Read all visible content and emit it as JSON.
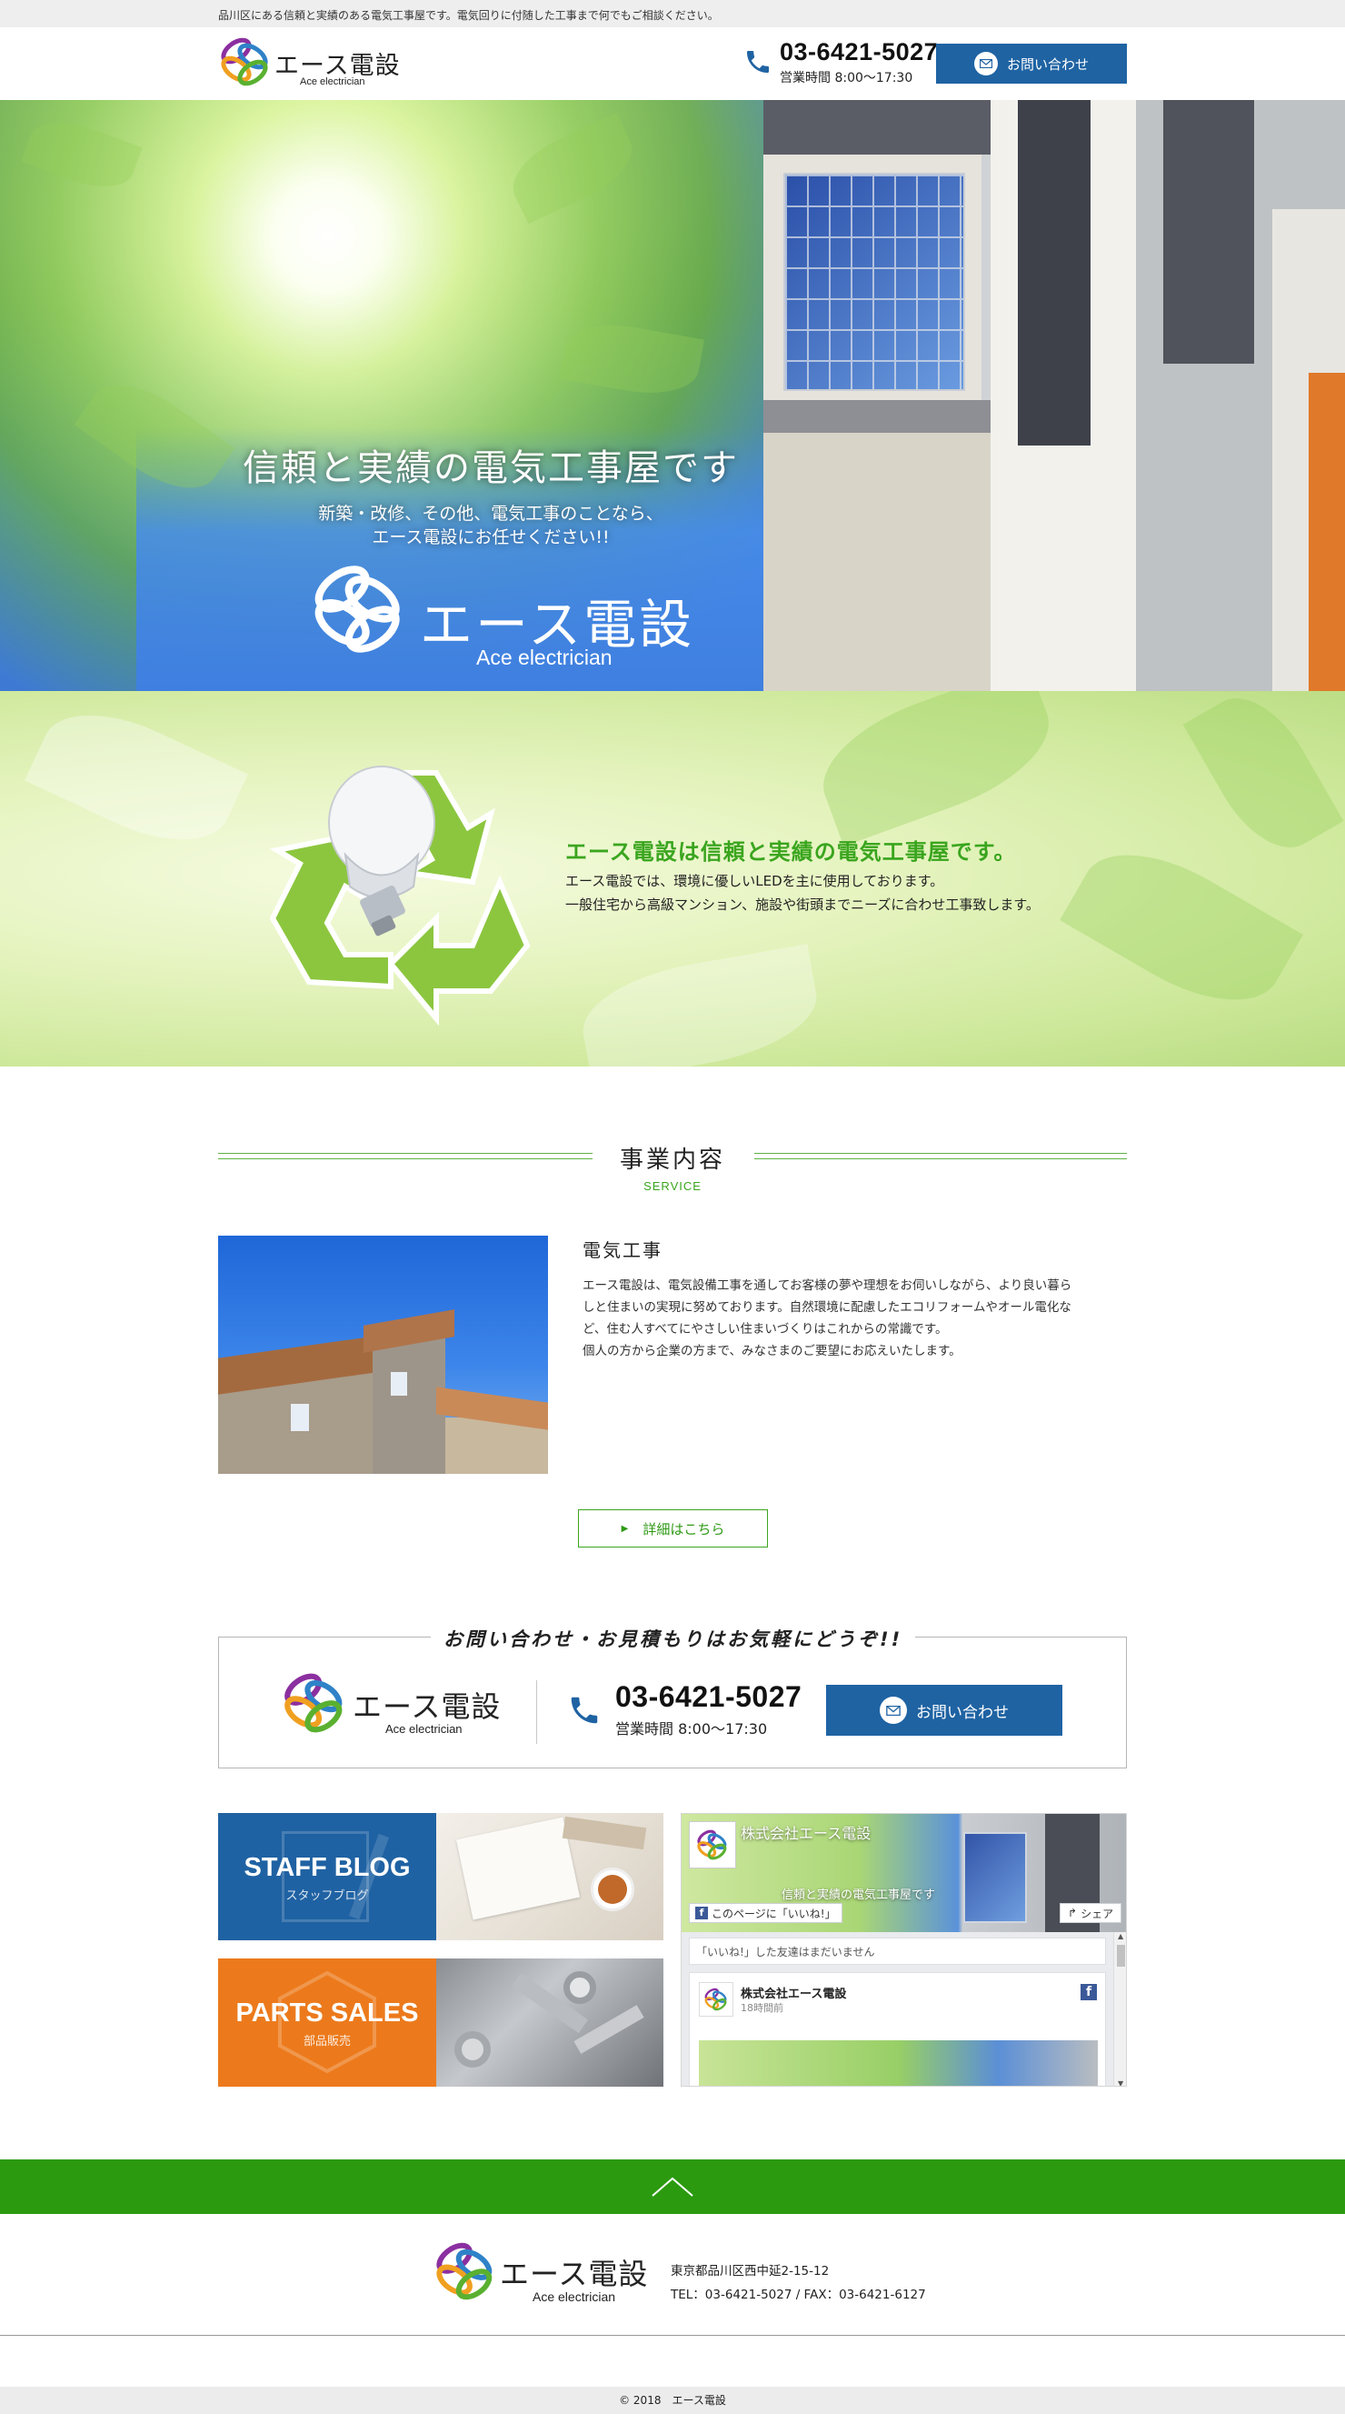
{
  "topbar": {
    "text": "品川区にある信頼と実績のある電気工事屋です。電気回りに付随した工事まで何でもご相談ください。"
  },
  "brand": {
    "name": "エース電設",
    "sub": "Ace electrician"
  },
  "contact": {
    "phone": "03-6421-5027",
    "hours": "営業時間 8:00〜17:30",
    "button_label": "お問い合わせ"
  },
  "hero": {
    "title": "信頼と実績の電気工事屋です",
    "line1": "新築・改修、その他、電気工事のことなら、",
    "line2": "エース電設にお任せください!!"
  },
  "intro": {
    "heading": "エース電設は信頼と実績の電気工事屋です。",
    "line1": "エース電設では、環境に優しいLEDを主に使用しております。",
    "line2": "一般住宅から高級マンション、施設や街頭までニーズに合わせ工事致します。"
  },
  "service": {
    "title": "事業内容",
    "subtitle": "SERVICE",
    "item_title": "電気工事",
    "p1": "エース電設は、電気設備工事を通してお客様の夢や理想をお伺いしながら、より良い暮ら",
    "p2": "しと住まいの実現に努めております。自然環境に配慮したエコリフォームやオール電化な",
    "p3": "ど、住む人すべてにやさしい住まいづくりはこれからの常識です。",
    "p4": "個人の方から企業の方まで、みなさまのご要望にお応えいたします。",
    "detail_button": "詳細はこちら"
  },
  "contact_box": {
    "title": "お問い合わせ・お見積もりはお気軽にどうぞ!!"
  },
  "banners": {
    "blog_title": "STAFF BLOG",
    "blog_sub": "スタッフブログ",
    "parts_title": "PARTS SALES",
    "parts_sub": "部品販売"
  },
  "facebook": {
    "page_name": "株式会社エース電設",
    "cover_text": "信頼と実績の電気工事屋です",
    "like_label": "このページに「いいね!」",
    "share_label": "シェア",
    "friends_text": "「いいね!」した友達はまだいません",
    "post_author": "株式会社エース電設",
    "post_time": "18時間前"
  },
  "footer": {
    "address": "東京都品川区西中延2-15-12",
    "telfax": "TEL：03-6421-5027 / FAX：03-6421-6127",
    "copyright": "© 2018　エース電設"
  },
  "colors": {
    "accent_green": "#3aa51e",
    "footer_green": "#2b9a0f",
    "button_blue": "#1f63a3",
    "blog_blue": "#1f62a3",
    "parts_orange": "#ec7a1c"
  }
}
